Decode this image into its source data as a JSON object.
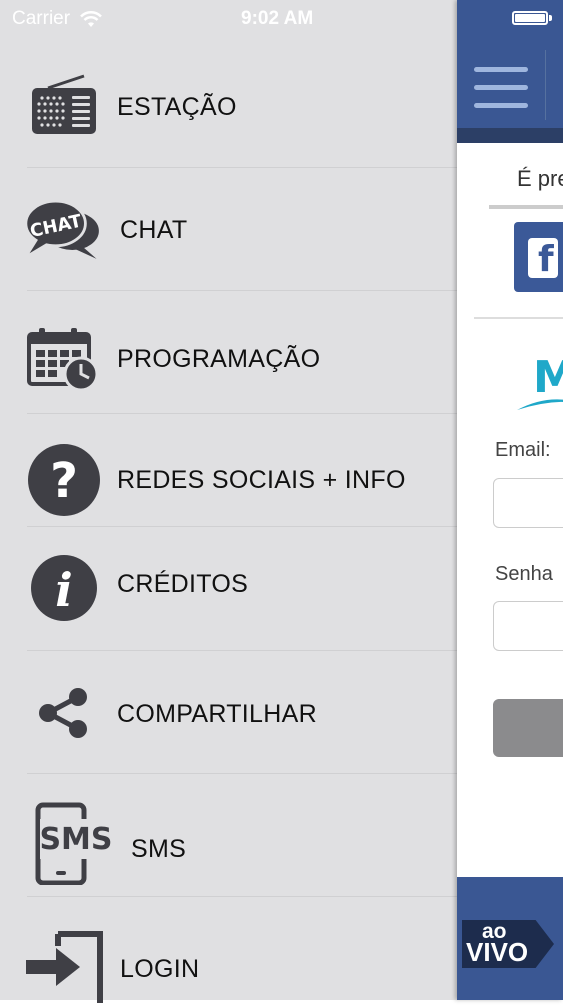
{
  "status_bar": {
    "carrier": "Carrier",
    "time": "9:02 AM"
  },
  "menu": {
    "items": [
      {
        "label": "ESTAÇÃO",
        "icon": "radio-icon"
      },
      {
        "label": "CHAT",
        "icon": "chat-bubbles-icon",
        "icon_text": "CHAT"
      },
      {
        "label": "PROGRAMAÇÃO",
        "icon": "calendar-clock-icon"
      },
      {
        "label": "REDES SOCIAIS + INFO",
        "icon": "question-icon"
      },
      {
        "label": "CRÉDITOS",
        "icon": "info-icon"
      },
      {
        "label": "COMPARTILHAR",
        "icon": "share-icon"
      },
      {
        "label": "SMS",
        "icon": "sms-phone-icon",
        "icon_text": "SMS"
      },
      {
        "label": "LOGIN",
        "icon": "login-arrow-icon"
      }
    ]
  },
  "panel": {
    "intro_text": "É pre",
    "email_label": "Email:",
    "password_label": "Senha",
    "logo_letter": "M",
    "live_badge": {
      "line1": "ao",
      "line2": "VIVO"
    }
  },
  "colors": {
    "menu_bg": "#e0e0e2",
    "header_blue": "#3a5793",
    "icon_gray": "#3f3f45",
    "logo_cyan": "#1fa8c9"
  }
}
